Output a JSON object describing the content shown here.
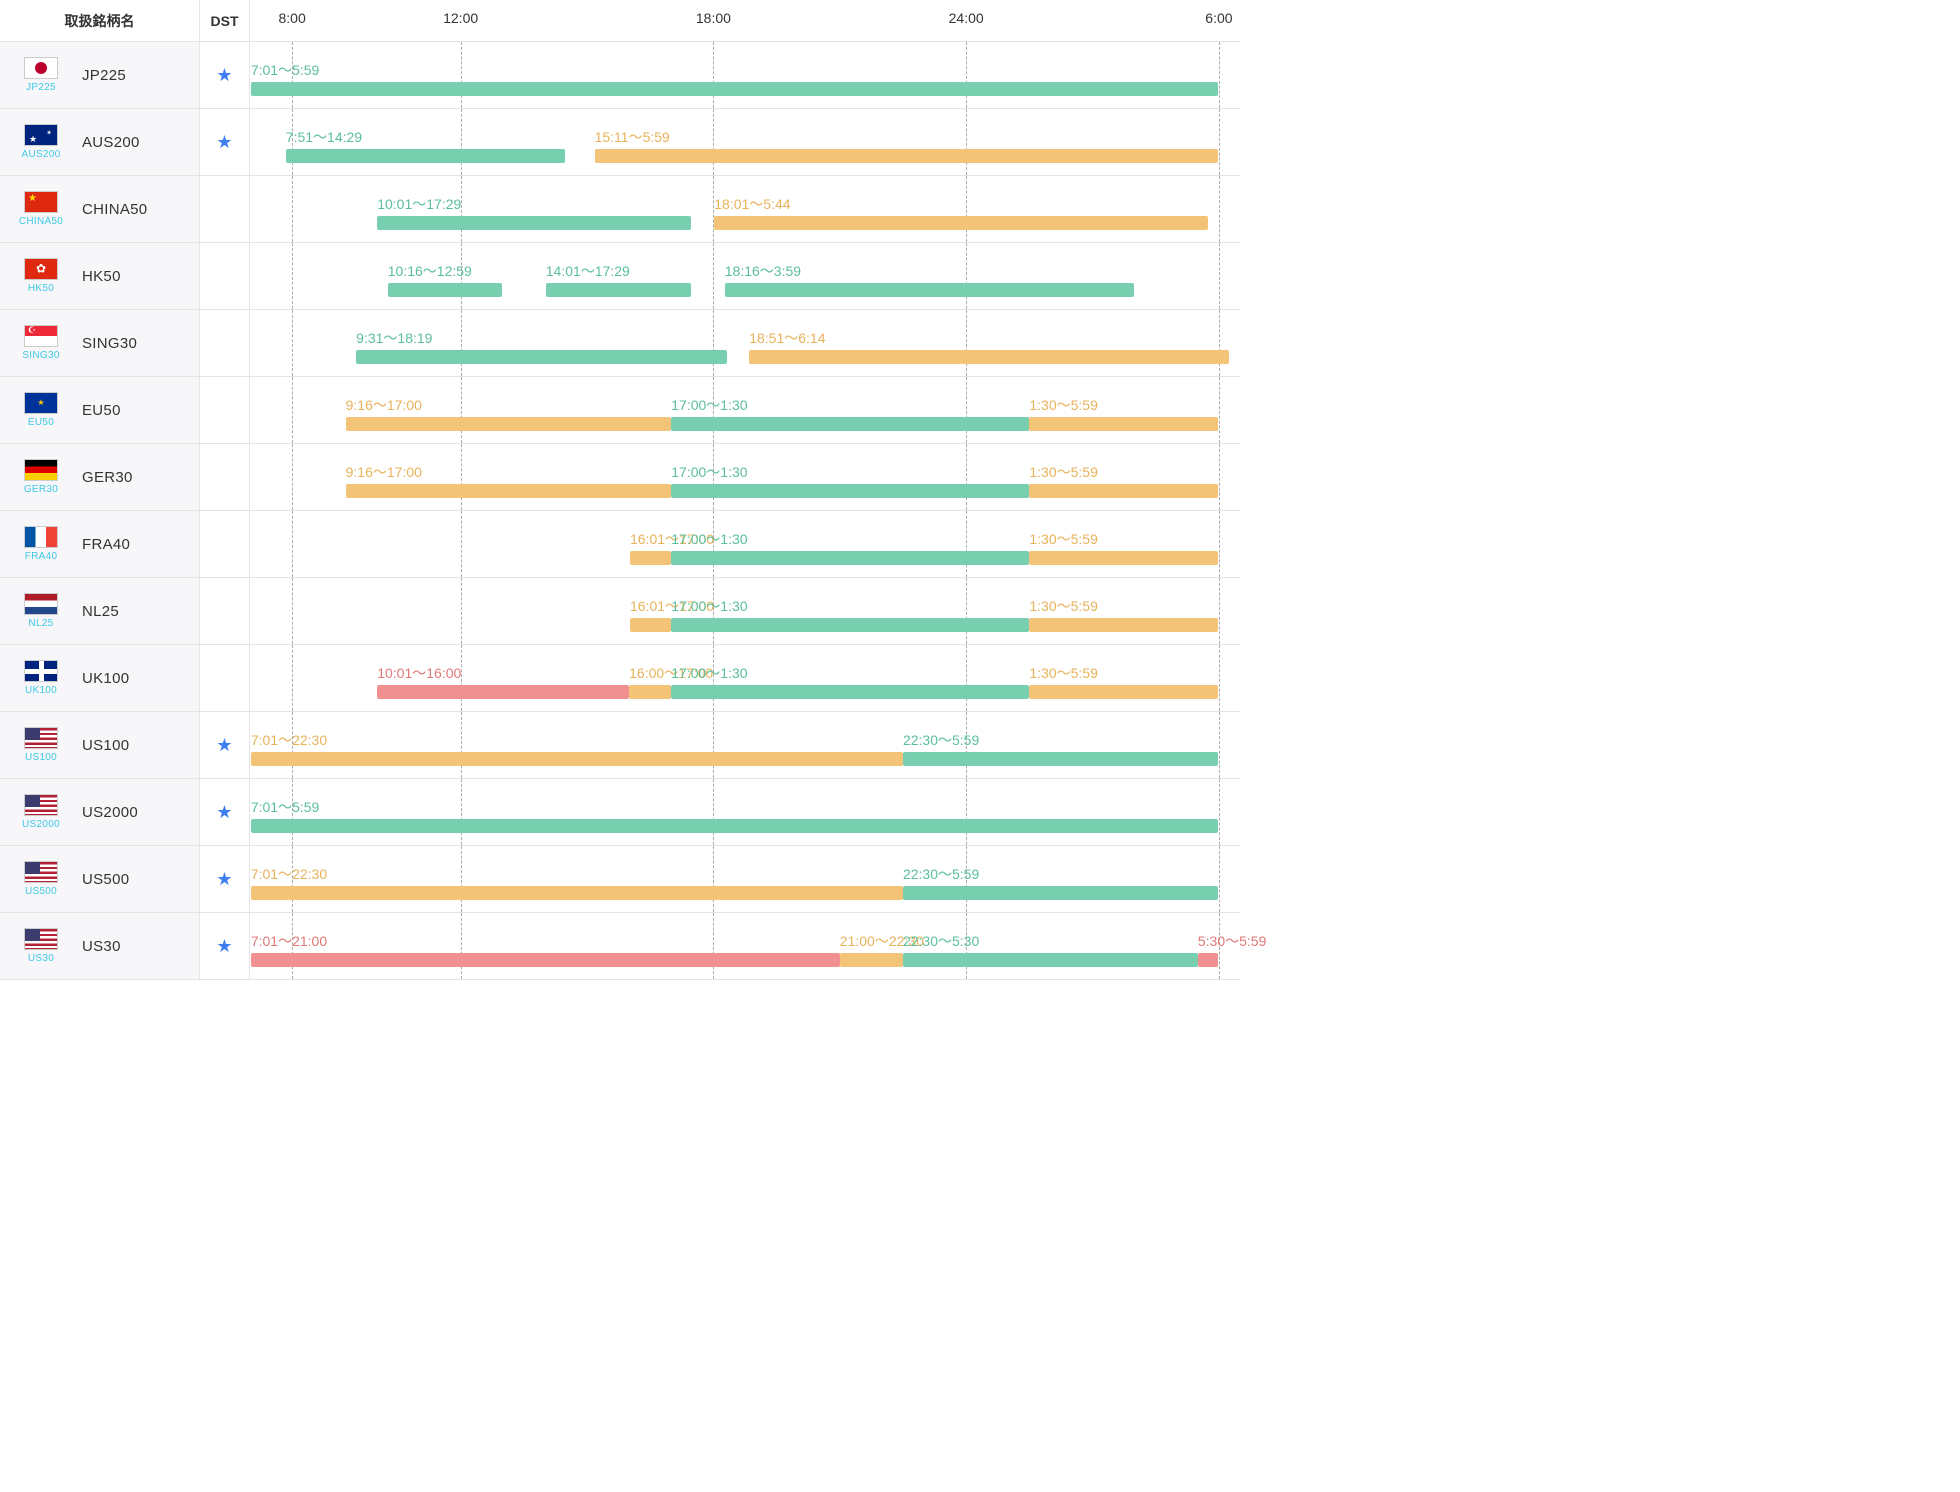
{
  "header": {
    "name_label": "取扱銘柄名",
    "dst_label": "DST"
  },
  "timeline": {
    "start_hour": 7.0,
    "end_hour": 30.5,
    "ticks": [
      {
        "hour": 8,
        "label": "8:00"
      },
      {
        "hour": 12,
        "label": "12:00"
      },
      {
        "hour": 18,
        "label": "18:00"
      },
      {
        "hour": 24,
        "label": "24:00"
      },
      {
        "hour": 30,
        "label": "6:00"
      }
    ]
  },
  "colors": {
    "green": "#77cfb0",
    "orange": "#f3c477",
    "pink": "#f09090"
  },
  "chart_data": {
    "type": "gantt",
    "x_unit": "hour (JST, wraps past 24)",
    "x_range": [
      7.0,
      30.5
    ],
    "rows": [
      {
        "code": "JP225",
        "name": "JP225",
        "flag": "jp",
        "dst": true,
        "segments": [
          {
            "label": "7:01～5:59",
            "start": 7.02,
            "end": 29.98,
            "color": "green"
          }
        ]
      },
      {
        "code": "AUS200",
        "name": "AUS200",
        "flag": "au",
        "dst": true,
        "segments": [
          {
            "label": "7:51～14:29",
            "start": 7.85,
            "end": 14.48,
            "color": "green"
          },
          {
            "label": "15:11～5:59",
            "start": 15.18,
            "end": 29.98,
            "color": "orange"
          }
        ]
      },
      {
        "code": "CHINA50",
        "name": "CHINA50",
        "flag": "cn",
        "dst": false,
        "segments": [
          {
            "label": "10:01～17:29",
            "start": 10.02,
            "end": 17.48,
            "color": "green"
          },
          {
            "label": "18:01～5:44",
            "start": 18.02,
            "end": 29.73,
            "color": "orange"
          }
        ]
      },
      {
        "code": "HK50",
        "name": "HK50",
        "flag": "hk",
        "dst": false,
        "segments": [
          {
            "label": "10:16～12:59",
            "start": 10.27,
            "end": 12.98,
            "color": "green"
          },
          {
            "label": "14:01～17:29",
            "start": 14.02,
            "end": 17.48,
            "color": "green"
          },
          {
            "label": "18:16～3:59",
            "start": 18.27,
            "end": 27.98,
            "color": "green"
          }
        ]
      },
      {
        "code": "SING30",
        "name": "SING30",
        "flag": "sg",
        "dst": false,
        "segments": [
          {
            "label": "9:31～18:19",
            "start": 9.52,
            "end": 18.32,
            "color": "green"
          },
          {
            "label": "18:51～6:14",
            "start": 18.85,
            "end": 30.23,
            "color": "orange"
          }
        ]
      },
      {
        "code": "EU50",
        "name": "EU50",
        "flag": "eu",
        "dst": false,
        "segments": [
          {
            "label": "9:16～17:00",
            "start": 9.27,
            "end": 17.0,
            "color": "orange"
          },
          {
            "label": "17:00～1:30",
            "start": 17.0,
            "end": 25.5,
            "color": "green"
          },
          {
            "label": "1:30～5:59",
            "start": 25.5,
            "end": 29.98,
            "color": "orange"
          }
        ]
      },
      {
        "code": "GER30",
        "name": "GER30",
        "flag": "de",
        "dst": false,
        "segments": [
          {
            "label": "9:16～17:00",
            "start": 9.27,
            "end": 17.0,
            "color": "orange"
          },
          {
            "label": "17:00～1:30",
            "start": 17.0,
            "end": 25.5,
            "color": "green"
          },
          {
            "label": "1:30～5:59",
            "start": 25.5,
            "end": 29.98,
            "color": "orange"
          }
        ]
      },
      {
        "code": "FRA40",
        "name": "FRA40",
        "flag": "fr",
        "dst": false,
        "segments": [
          {
            "label": "16:01～17:00",
            "start": 16.02,
            "end": 17.0,
            "color": "orange"
          },
          {
            "label": "17:00～1:30",
            "start": 17.0,
            "end": 25.5,
            "color": "green"
          },
          {
            "label": "1:30～5:59",
            "start": 25.5,
            "end": 29.98,
            "color": "orange"
          }
        ]
      },
      {
        "code": "NL25",
        "name": "NL25",
        "flag": "nl",
        "dst": false,
        "segments": [
          {
            "label": "16:01～17:00",
            "start": 16.02,
            "end": 17.0,
            "color": "orange"
          },
          {
            "label": "17:00～1:30",
            "start": 17.0,
            "end": 25.5,
            "color": "green"
          },
          {
            "label": "1:30～5:59",
            "start": 25.5,
            "end": 29.98,
            "color": "orange"
          }
        ]
      },
      {
        "code": "UK100",
        "name": "UK100",
        "flag": "uk",
        "dst": false,
        "segments": [
          {
            "label": "10:01～16:00",
            "start": 10.02,
            "end": 16.0,
            "color": "pink"
          },
          {
            "label": "16:00～17:00",
            "start": 16.0,
            "end": 17.0,
            "color": "orange"
          },
          {
            "label": "17:00～1:30",
            "start": 17.0,
            "end": 25.5,
            "color": "green"
          },
          {
            "label": "1:30～5:59",
            "start": 25.5,
            "end": 29.98,
            "color": "orange"
          }
        ]
      },
      {
        "code": "US100",
        "name": "US100",
        "flag": "us",
        "dst": true,
        "segments": [
          {
            "label": "7:01～22:30",
            "start": 7.02,
            "end": 22.5,
            "color": "orange"
          },
          {
            "label": "22:30～5:59",
            "start": 22.5,
            "end": 29.98,
            "color": "green"
          }
        ]
      },
      {
        "code": "US2000",
        "name": "US2000",
        "flag": "us",
        "dst": true,
        "segments": [
          {
            "label": "7:01～5:59",
            "start": 7.02,
            "end": 29.98,
            "color": "green"
          }
        ]
      },
      {
        "code": "US500",
        "name": "US500",
        "flag": "us",
        "dst": true,
        "segments": [
          {
            "label": "7:01～22:30",
            "start": 7.02,
            "end": 22.5,
            "color": "orange"
          },
          {
            "label": "22:30～5:59",
            "start": 22.5,
            "end": 29.98,
            "color": "green"
          }
        ]
      },
      {
        "code": "US30",
        "name": "US30",
        "flag": "us",
        "dst": true,
        "segments": [
          {
            "label": "7:01～21:00",
            "start": 7.02,
            "end": 21.0,
            "color": "pink"
          },
          {
            "label": "21:00～22:30",
            "start": 21.0,
            "end": 22.5,
            "color": "orange"
          },
          {
            "label": "22:30～5:30",
            "start": 22.5,
            "end": 29.5,
            "color": "green"
          },
          {
            "label": "5:30～5:59",
            "start": 29.5,
            "end": 29.98,
            "color": "pink"
          }
        ]
      }
    ]
  }
}
